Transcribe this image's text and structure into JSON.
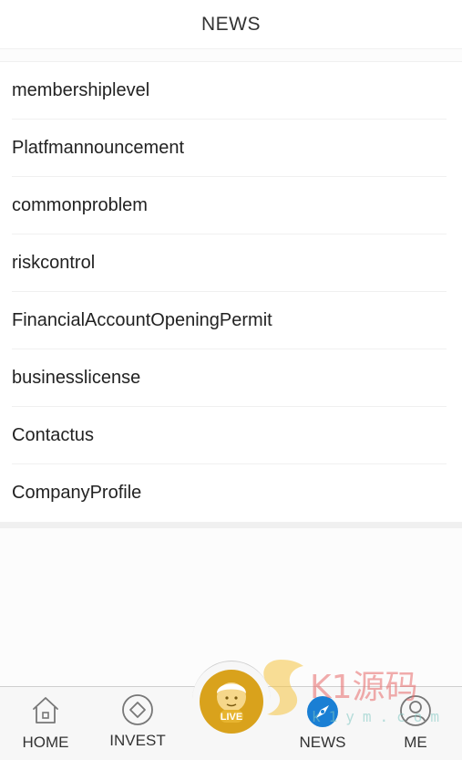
{
  "header": {
    "title": "NEWS"
  },
  "list": {
    "items": [
      {
        "label": "membershiplevel"
      },
      {
        "label": "Platfmannouncement"
      },
      {
        "label": "commonproblem"
      },
      {
        "label": "riskcontrol"
      },
      {
        "label": "FinancialAccountOpeningPermit"
      },
      {
        "label": "businesslicense"
      },
      {
        "label": "Contactus"
      },
      {
        "label": "CompanyProfile"
      }
    ]
  },
  "tabbar": {
    "home": {
      "label": "HOME",
      "icon": "home-icon"
    },
    "invest": {
      "label": "INVEST",
      "icon": "diamond-icon"
    },
    "live": {
      "label": "LIVE",
      "icon": "live-avatar-icon",
      "color": "#d9a21c"
    },
    "news": {
      "label": "NEWS",
      "icon": "compass-icon",
      "color": "#1a7fd4"
    },
    "me": {
      "label": "ME",
      "icon": "user-icon"
    }
  },
  "watermark": {
    "text": "K1源码",
    "subtext": "k1ym.com"
  }
}
